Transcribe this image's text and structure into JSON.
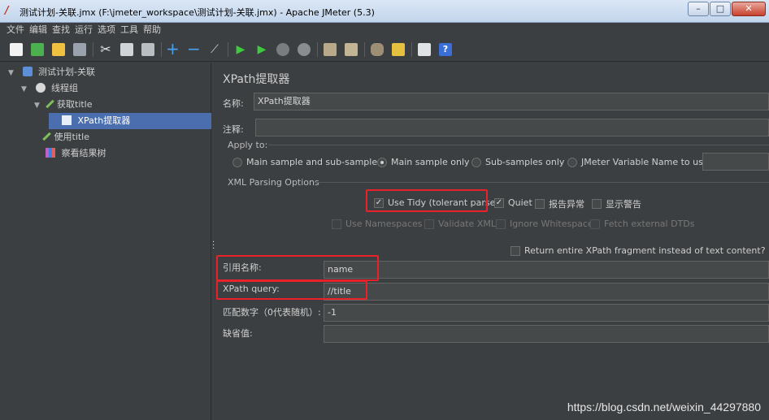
{
  "window": {
    "title": "测试计划-关联.jmx (F:\\jmeter_workspace\\测试计划-关联.jmx) - Apache JMeter (5.3)",
    "buttons": {
      "minimize": "–",
      "maximize": "□",
      "close": "✕"
    }
  },
  "menu": [
    "文件",
    "编辑",
    "查找",
    "运行",
    "选项",
    "工具",
    "帮助"
  ],
  "toolbar_icons": [
    "new-icon",
    "templates-icon",
    "open-icon",
    "save-icon",
    "cut-icon",
    "copy-icon",
    "paste-icon",
    "expand-icon",
    "collapse-icon",
    "toggle-icon",
    "start-icon",
    "start-no-pause-icon",
    "stop-icon",
    "shutdown-icon",
    "clear-icon",
    "clear-all-icon",
    "search-icon",
    "reset-search-icon",
    "function-helper-icon",
    "help-icon"
  ],
  "tree": {
    "items": [
      {
        "label": "测试计划-关联",
        "icon": "test-plan-icon"
      },
      {
        "label": "线程组",
        "icon": "thread-group-icon"
      },
      {
        "label": "获取title",
        "icon": "sampler-icon"
      },
      {
        "label": "XPath提取器",
        "icon": "extractor-icon"
      },
      {
        "label": "使用title",
        "icon": "sampler-icon"
      },
      {
        "label": "察看结果树",
        "icon": "listener-icon"
      }
    ]
  },
  "panel": {
    "heading": "XPath提取器",
    "name_label": "名称:",
    "name_value": "XPath提取器",
    "comment_label": "注释:",
    "comment_value": "",
    "apply_to": {
      "label": "Apply to:",
      "options": [
        "Main sample and sub-samples",
        "Main sample only",
        "Sub-samples only",
        "JMeter Variable Name to use"
      ],
      "selected": "Main sample only",
      "variable_value": ""
    },
    "xml_parsing": {
      "label": "XML Parsing Options",
      "use_tidy": "Use Tidy (tolerant parser)",
      "quiet": "Quiet",
      "report_errors": "报告异常",
      "show_warnings": "显示警告",
      "use_namespaces": "Use Namespaces",
      "validate_xml": "Validate XML",
      "ignore_whitespace": "Ignore Whitespace",
      "fetch_dtds": "Fetch external DTDs",
      "return_fragment": "Return entire XPath fragment instead of text content?",
      "check_mark": "✓"
    },
    "ref_name_label": "引用名称:",
    "ref_name_value": "name",
    "xpath_label": "XPath query:",
    "xpath_value": "//title",
    "match_no_label": "匹配数字（0代表随机）:",
    "match_no_value": "-1",
    "default_label": "缺省值:",
    "default_value": ""
  },
  "watermark": "https://blog.csdn.net/weixin_44297880"
}
